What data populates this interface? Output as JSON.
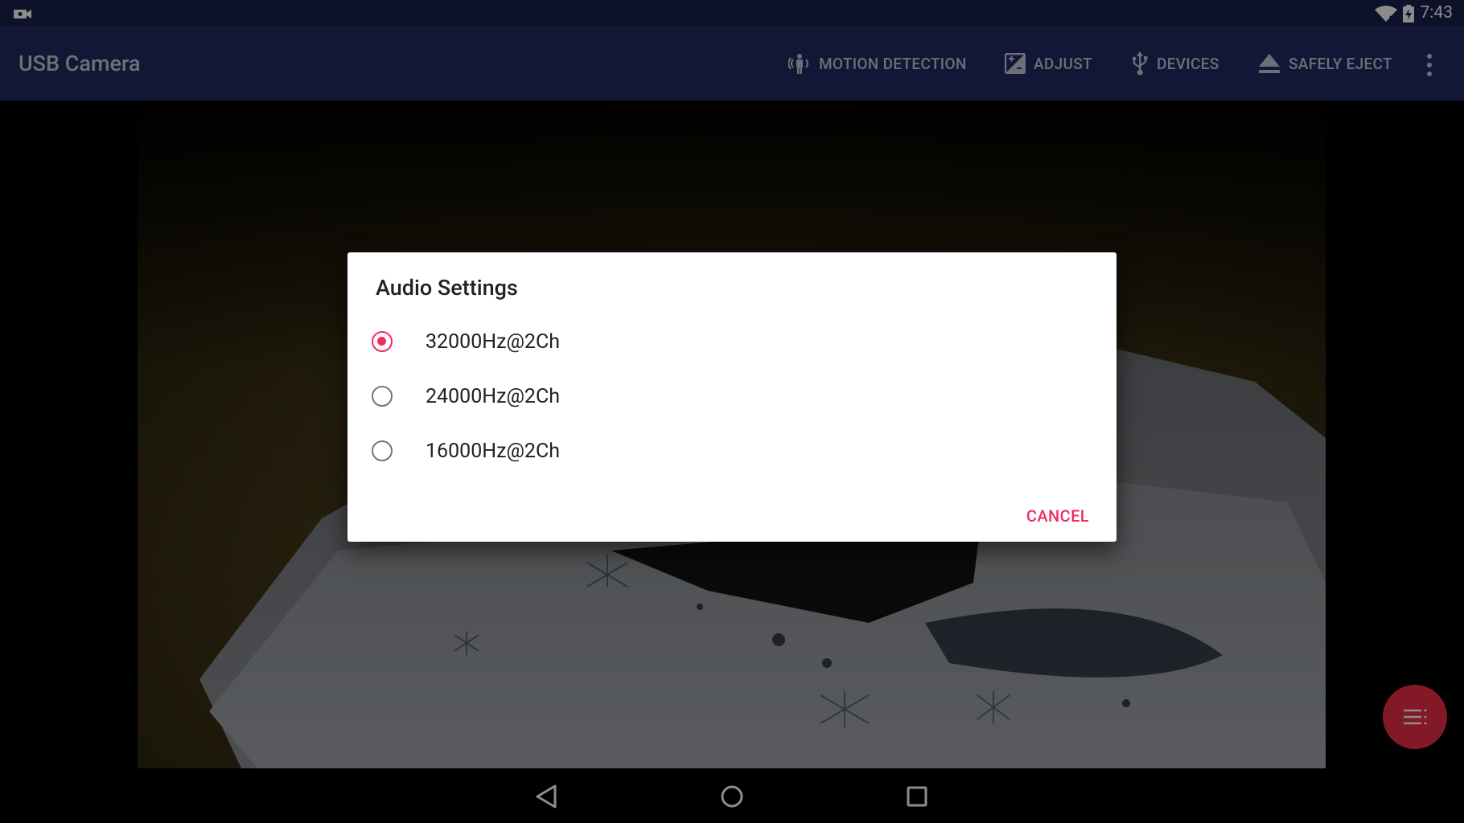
{
  "status_bar": {
    "time": "7:43",
    "icons": [
      "video-camera-icon",
      "wifi-icon",
      "battery-charging-icon"
    ]
  },
  "toolbar": {
    "title": "USB Camera",
    "actions": [
      {
        "label": "MOTION DETECTION",
        "icon": "motion-detection-icon"
      },
      {
        "label": "ADJUST",
        "icon": "adjust-icon"
      },
      {
        "label": "DEVICES",
        "icon": "usb-icon"
      },
      {
        "label": "SAFELY EJECT",
        "icon": "eject-icon"
      }
    ],
    "overflow_icon": "more-vert-icon"
  },
  "dialog": {
    "title": "Audio Settings",
    "options": [
      {
        "label": "32000Hz@2Ch",
        "selected": true
      },
      {
        "label": "24000Hz@2Ch",
        "selected": false
      },
      {
        "label": "16000Hz@2Ch",
        "selected": false
      }
    ],
    "cancel_label": "CANCEL",
    "accent_color": "#ee2d5f"
  },
  "fab": {
    "icon": "menu-list-icon",
    "color": "#ef2e48"
  },
  "nav_bar": {
    "icons": [
      "back-icon",
      "home-icon",
      "recents-icon"
    ]
  },
  "colors": {
    "status_bar": "#18204b",
    "toolbar": "#212a63"
  }
}
